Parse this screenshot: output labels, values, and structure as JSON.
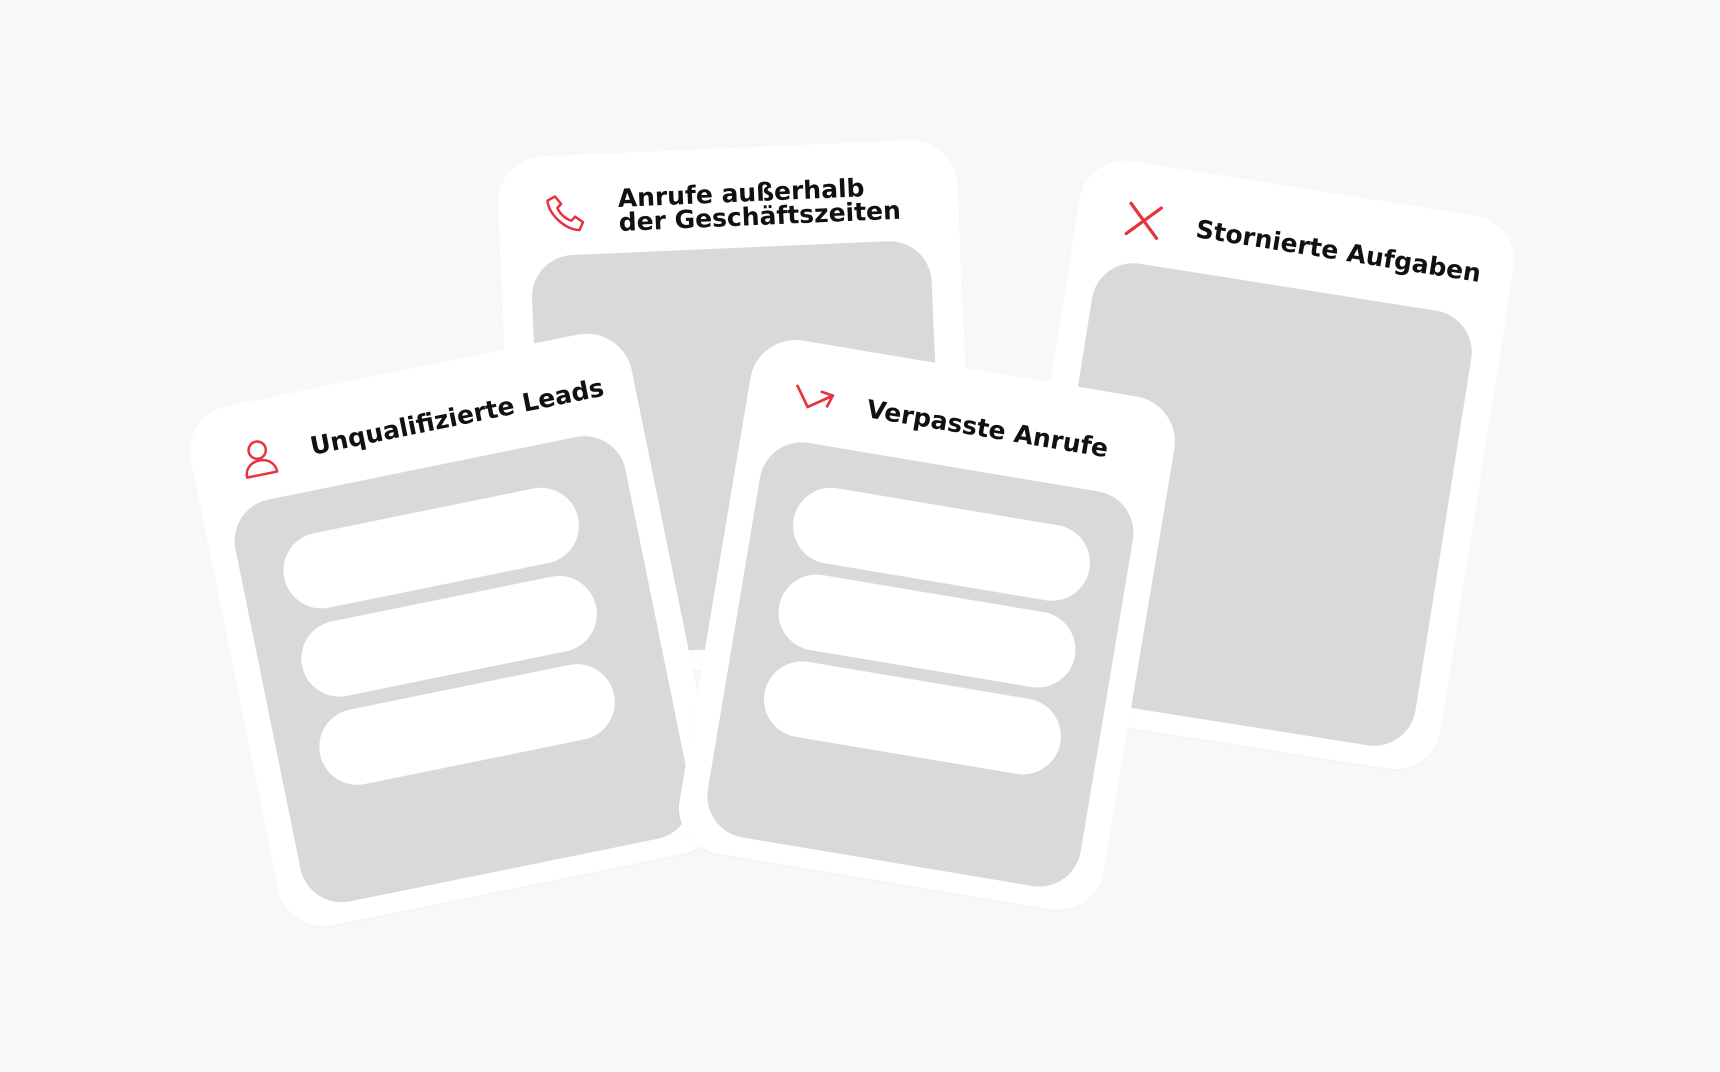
{
  "colors": {
    "background": "#f7f8fa",
    "card": "#ffffff",
    "panel": "#d9d9d9",
    "accent": "#e8323c",
    "title": "#111111"
  },
  "cards": {
    "phone": {
      "title": "Anrufe außerhalb\nder Geschäftszeiten",
      "icon": "phone-icon"
    },
    "cancel": {
      "title": "Stornierte Aufgaben",
      "icon": "close-icon"
    },
    "leads": {
      "title": "Unqualifizierte Leads",
      "icon": "user-icon"
    },
    "missed": {
      "title": "Verpasste Anrufe",
      "icon": "missed-call-arrow-icon"
    }
  }
}
